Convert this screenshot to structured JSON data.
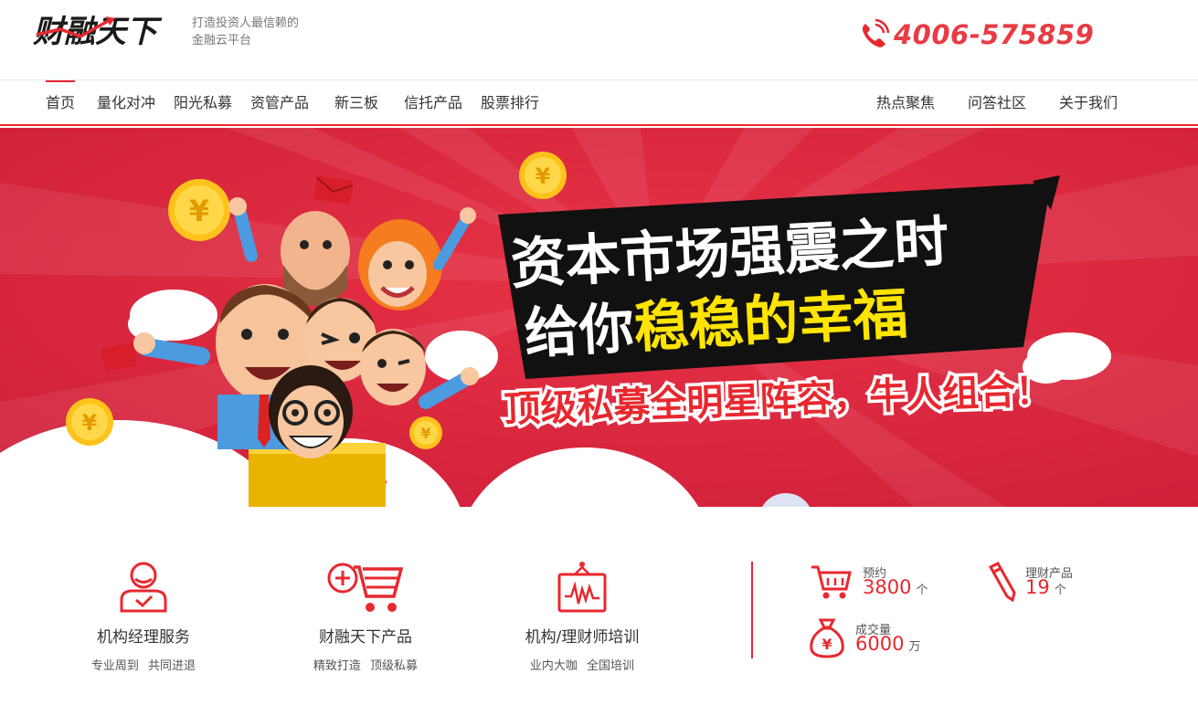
{
  "header": {
    "logo_text": "财融天下",
    "tagline_line1": "打造投资人最信赖的",
    "tagline_line2": "金融云平台",
    "phone": "4006-575859"
  },
  "nav": {
    "left": [
      "首页",
      "量化对冲",
      "阳光私募",
      "资管产品",
      "新三板",
      "信托产品",
      "股票排行"
    ],
    "right": [
      "热点聚焦",
      "问答社区",
      "关于我们"
    ],
    "active": "首页"
  },
  "banner": {
    "headline_line1": "资本市场强震之时",
    "headline_line2_a": "给你",
    "headline_line2_b": "稳稳的幸福",
    "subheadline": "顶级私募全明星阵容，牛人组合！",
    "coin_symbol": "¥"
  },
  "services": [
    {
      "icon": "manager-service-icon",
      "title": "机构经理服务",
      "subtitle": "专业周到 共同进退"
    },
    {
      "icon": "shopping-cart-plus-icon",
      "title": "财融天下产品",
      "subtitle": "精致打造 顶级私募"
    },
    {
      "icon": "training-monitor-icon",
      "title": "机构/理财师培训",
      "subtitle": "业内大咖 全国培训"
    }
  ],
  "stats": [
    {
      "icon": "cart-icon",
      "label": "预约",
      "value": "3800",
      "unit": "个"
    },
    {
      "icon": "pencil-icon",
      "label": "理财产品",
      "value": "19",
      "unit": "个"
    },
    {
      "icon": "money-bag-icon",
      "label": "成交量",
      "value": "6000",
      "unit": "万"
    }
  ],
  "colors": {
    "accent": "#e8282f",
    "banner_bg": "#d8283d",
    "highlight_yellow": "#ffe400"
  }
}
